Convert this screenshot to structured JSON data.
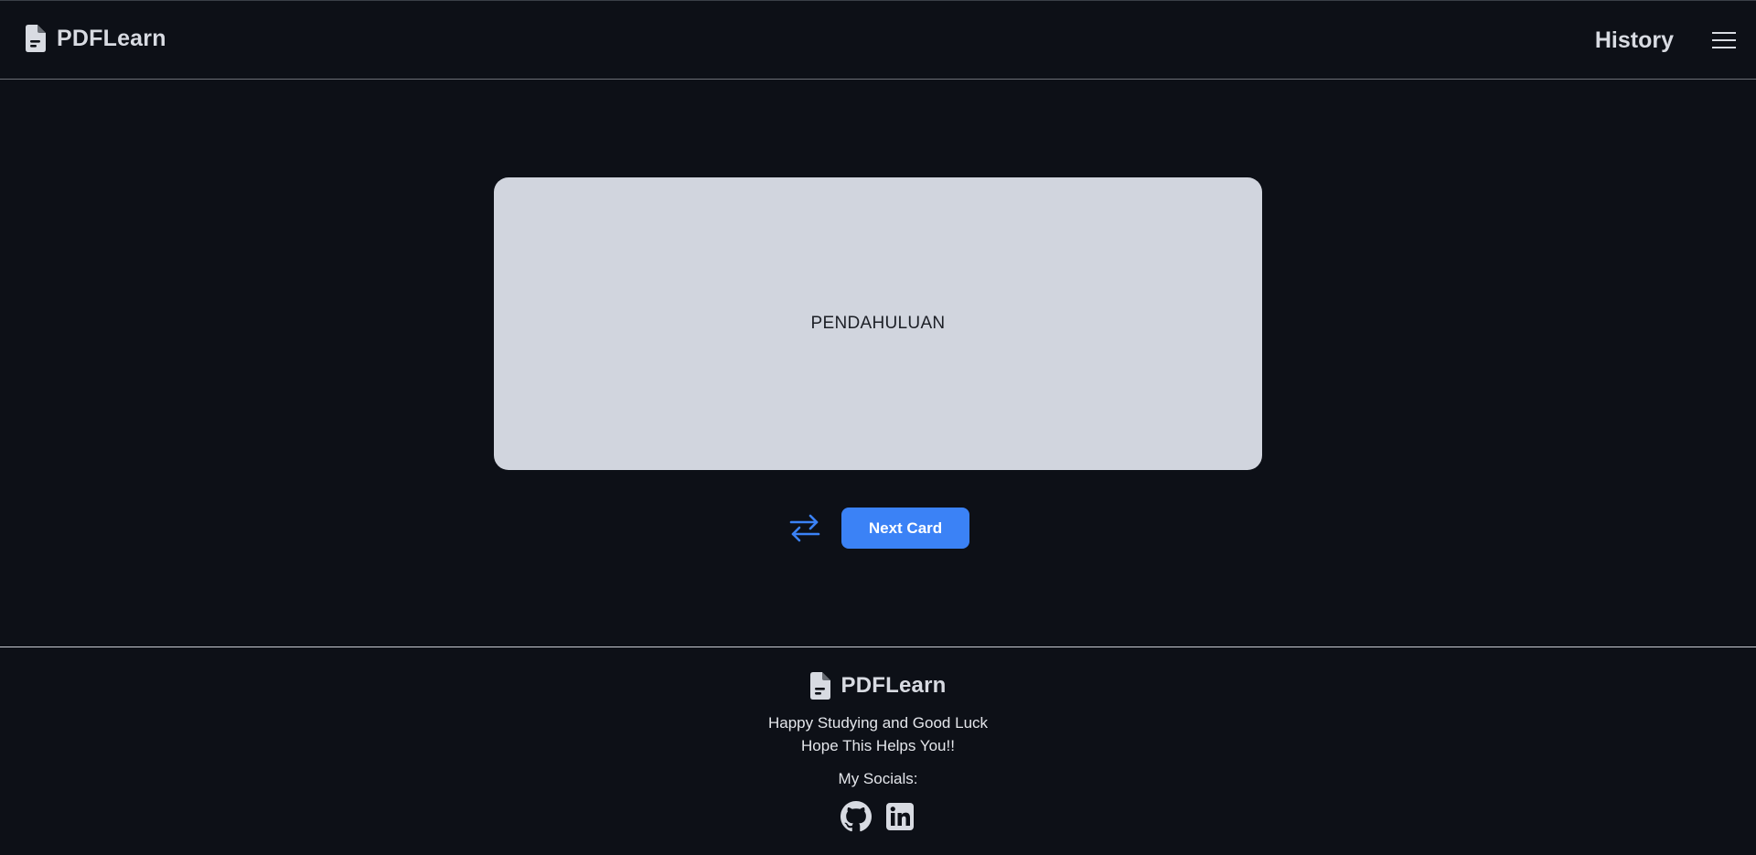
{
  "header": {
    "brand_name": "PDFLearn",
    "brand_icon": "document-icon",
    "history_label": "History",
    "menu_icon": "hamburger-menu-icon"
  },
  "flashcard": {
    "text": "PENDAHULUAN"
  },
  "controls": {
    "flip_icon": "swap-arrows-icon",
    "next_label": "Next Card"
  },
  "footer": {
    "brand_name": "PDFLearn",
    "brand_icon": "document-icon",
    "line1": "Happy Studying and Good Luck",
    "line2": "Hope This Helps You!!",
    "socials_label": "My Socials:",
    "socials": [
      {
        "icon": "github-icon"
      },
      {
        "icon": "linkedin-icon"
      }
    ]
  },
  "colors": {
    "background": "#0d1017",
    "card": "#d1d5de",
    "accent": "#3b82f6",
    "text": "#d8dbe2"
  }
}
